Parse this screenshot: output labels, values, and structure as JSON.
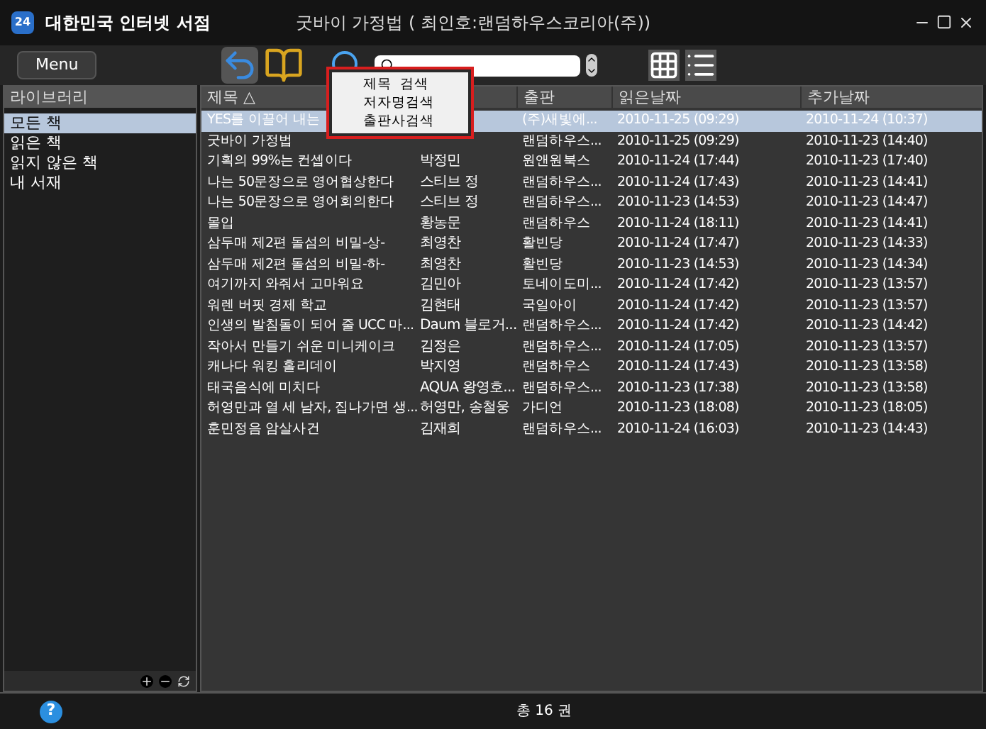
{
  "window": {
    "logo": "24",
    "app_name": "대한민국 인터넷 서점",
    "title": "굿바이 가정법 ( 최인호:랜덤하우스코리아(주))"
  },
  "toolbar": {
    "menu_button": "Menu"
  },
  "search_menu": {
    "items": [
      "제목  검색",
      "저자명검색",
      "출판사검색"
    ]
  },
  "sidebar": {
    "heading": "라이브러리",
    "items": [
      {
        "label": "모든 책",
        "selected": true
      },
      {
        "label": "읽은 책",
        "selected": false
      },
      {
        "label": "읽지 않은 책",
        "selected": false
      },
      {
        "label": "내 서재",
        "selected": false
      }
    ]
  },
  "table": {
    "columns": [
      "제목 △",
      "출판",
      "읽은날짜",
      "추가날짜"
    ],
    "rows": [
      {
        "title": "YES를 이끌어 내는",
        "publisher": "(주)새빛에...",
        "read": "2010-11-25 (09:29)",
        "added": "2010-11-24 (10:37)",
        "selected": true
      },
      {
        "title": "굿바이 가정법",
        "publisher": "랜덤하우스...",
        "read": "2010-11-25 (09:29)",
        "added": "2010-11-23 (14:40)",
        "selected": false
      },
      {
        "title": "기획의 99%는 컨셉이다",
        "author": "박정민",
        "publisher": "원앤원북스",
        "read": "2010-11-24 (17:44)",
        "added": "2010-11-23 (17:40)",
        "selected": false
      },
      {
        "title": "나는 50문장으로 영어협상한다",
        "author": "스티브 정",
        "publisher": "랜덤하우스...",
        "read": "2010-11-24 (17:43)",
        "added": "2010-11-23 (14:41)",
        "selected": false
      },
      {
        "title": "나는 50문장으로 영어회의한다",
        "author": "스티브 정",
        "publisher": "랜덤하우스...",
        "read": "2010-11-23 (14:53)",
        "added": "2010-11-23 (14:47)",
        "selected": false
      },
      {
        "title": "몰입",
        "author": "황농문",
        "publisher": "랜덤하우스",
        "read": "2010-11-24 (18:11)",
        "added": "2010-11-23 (14:41)",
        "selected": false
      },
      {
        "title": "삼두매 제2편 돌섬의 비밀-상-",
        "author": "최영찬",
        "publisher": "활빈당",
        "read": "2010-11-24 (17:47)",
        "added": "2010-11-23 (14:33)",
        "selected": false
      },
      {
        "title": "삼두매 제2편 돌섬의 비밀-하-",
        "author": "최영찬",
        "publisher": "활빈당",
        "read": "2010-11-23 (14:53)",
        "added": "2010-11-23 (14:34)",
        "selected": false
      },
      {
        "title": "여기까지 와줘서 고마워요",
        "author": "김민아",
        "publisher": "토네이도미...",
        "read": "2010-11-24 (17:42)",
        "added": "2010-11-23 (13:57)",
        "selected": false
      },
      {
        "title": "워렌 버핏 경제 학교",
        "author": "김현태",
        "publisher": "국일아이",
        "read": "2010-11-24 (17:42)",
        "added": "2010-11-23 (13:57)",
        "selected": false
      },
      {
        "title": "인생의 발침돌이 되어 줄 UCC 마...",
        "author": "Daum 블로거...",
        "publisher": "랜덤하우스...",
        "read": "2010-11-24 (17:42)",
        "added": "2010-11-23 (14:42)",
        "selected": false
      },
      {
        "title": "작아서 만들기 쉬운 미니케이크",
        "author": "김정은",
        "publisher": "랜덤하우스...",
        "read": "2010-11-24 (17:05)",
        "added": "2010-11-23 (13:57)",
        "selected": false
      },
      {
        "title": "캐나다 워킹 홀리데이",
        "author": "박지영",
        "publisher": "랜덤하우스",
        "read": "2010-11-24 (17:43)",
        "added": "2010-11-23 (13:58)",
        "selected": false
      },
      {
        "title": "태국음식에 미치다",
        "author": "AQUA 왕영호...",
        "publisher": "랜덤하우스...",
        "read": "2010-11-23 (17:38)",
        "added": "2010-11-23 (13:58)",
        "selected": false
      },
      {
        "title": "허영만과 열 세 남자, 집나가면 생...",
        "author": "허영만, 송철웅",
        "publisher": "가디언",
        "read": "2010-11-23 (18:08)",
        "added": "2010-11-23 (18:05)",
        "selected": false
      },
      {
        "title": "훈민정음 암살사건",
        "author": "김재희",
        "publisher": "랜덤하우스...",
        "read": "2010-11-24 (16:03)",
        "added": "2010-11-23 (14:43)",
        "selected": false
      }
    ]
  },
  "status_bar": {
    "help": "?",
    "total": "총 16 권"
  }
}
